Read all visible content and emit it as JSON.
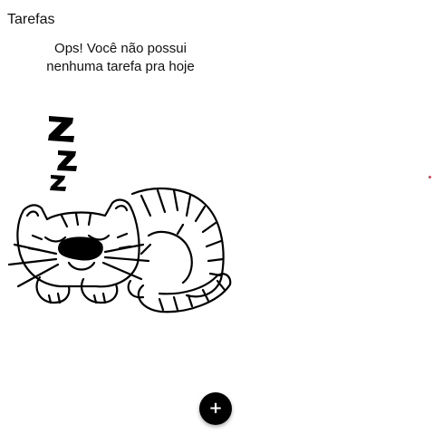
{
  "header": {
    "title": "Tarefas"
  },
  "empty_state": {
    "line1": "Ops! Você não possui",
    "line2": "nenhuma tarefa pra hoje",
    "illustration_icon": "sleeping-cat-illustration"
  },
  "fab": {
    "label": "+",
    "icon": "add-icon"
  },
  "colors": {
    "background": "#ffffff",
    "text": "#111111",
    "fab_background": "#000000",
    "fab_icon": "#ffffff",
    "status_dot": "#e53950"
  }
}
